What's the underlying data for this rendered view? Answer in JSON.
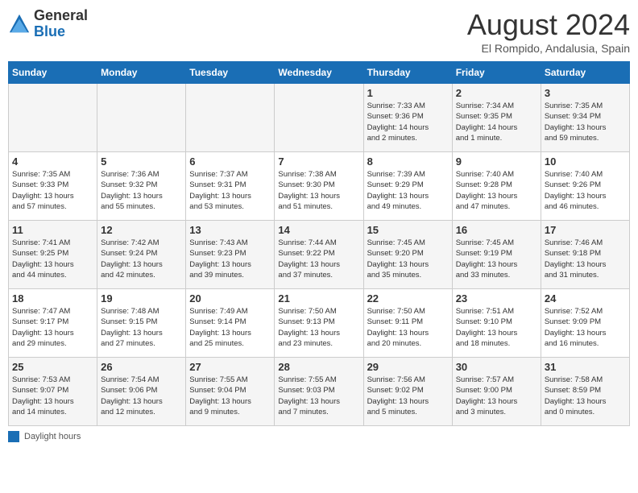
{
  "logo": {
    "general": "General",
    "blue": "Blue"
  },
  "title": {
    "month_year": "August 2024",
    "location": "El Rompido, Andalusia, Spain"
  },
  "weekdays": [
    "Sunday",
    "Monday",
    "Tuesday",
    "Wednesday",
    "Thursday",
    "Friday",
    "Saturday"
  ],
  "weeks": [
    [
      {
        "day": "",
        "info": ""
      },
      {
        "day": "",
        "info": ""
      },
      {
        "day": "",
        "info": ""
      },
      {
        "day": "",
        "info": ""
      },
      {
        "day": "1",
        "info": "Sunrise: 7:33 AM\nSunset: 9:36 PM\nDaylight: 14 hours\nand 2 minutes."
      },
      {
        "day": "2",
        "info": "Sunrise: 7:34 AM\nSunset: 9:35 PM\nDaylight: 14 hours\nand 1 minute."
      },
      {
        "day": "3",
        "info": "Sunrise: 7:35 AM\nSunset: 9:34 PM\nDaylight: 13 hours\nand 59 minutes."
      }
    ],
    [
      {
        "day": "4",
        "info": "Sunrise: 7:35 AM\nSunset: 9:33 PM\nDaylight: 13 hours\nand 57 minutes."
      },
      {
        "day": "5",
        "info": "Sunrise: 7:36 AM\nSunset: 9:32 PM\nDaylight: 13 hours\nand 55 minutes."
      },
      {
        "day": "6",
        "info": "Sunrise: 7:37 AM\nSunset: 9:31 PM\nDaylight: 13 hours\nand 53 minutes."
      },
      {
        "day": "7",
        "info": "Sunrise: 7:38 AM\nSunset: 9:30 PM\nDaylight: 13 hours\nand 51 minutes."
      },
      {
        "day": "8",
        "info": "Sunrise: 7:39 AM\nSunset: 9:29 PM\nDaylight: 13 hours\nand 49 minutes."
      },
      {
        "day": "9",
        "info": "Sunrise: 7:40 AM\nSunset: 9:28 PM\nDaylight: 13 hours\nand 47 minutes."
      },
      {
        "day": "10",
        "info": "Sunrise: 7:40 AM\nSunset: 9:26 PM\nDaylight: 13 hours\nand 46 minutes."
      }
    ],
    [
      {
        "day": "11",
        "info": "Sunrise: 7:41 AM\nSunset: 9:25 PM\nDaylight: 13 hours\nand 44 minutes."
      },
      {
        "day": "12",
        "info": "Sunrise: 7:42 AM\nSunset: 9:24 PM\nDaylight: 13 hours\nand 42 minutes."
      },
      {
        "day": "13",
        "info": "Sunrise: 7:43 AM\nSunset: 9:23 PM\nDaylight: 13 hours\nand 39 minutes."
      },
      {
        "day": "14",
        "info": "Sunrise: 7:44 AM\nSunset: 9:22 PM\nDaylight: 13 hours\nand 37 minutes."
      },
      {
        "day": "15",
        "info": "Sunrise: 7:45 AM\nSunset: 9:20 PM\nDaylight: 13 hours\nand 35 minutes."
      },
      {
        "day": "16",
        "info": "Sunrise: 7:45 AM\nSunset: 9:19 PM\nDaylight: 13 hours\nand 33 minutes."
      },
      {
        "day": "17",
        "info": "Sunrise: 7:46 AM\nSunset: 9:18 PM\nDaylight: 13 hours\nand 31 minutes."
      }
    ],
    [
      {
        "day": "18",
        "info": "Sunrise: 7:47 AM\nSunset: 9:17 PM\nDaylight: 13 hours\nand 29 minutes."
      },
      {
        "day": "19",
        "info": "Sunrise: 7:48 AM\nSunset: 9:15 PM\nDaylight: 13 hours\nand 27 minutes."
      },
      {
        "day": "20",
        "info": "Sunrise: 7:49 AM\nSunset: 9:14 PM\nDaylight: 13 hours\nand 25 minutes."
      },
      {
        "day": "21",
        "info": "Sunrise: 7:50 AM\nSunset: 9:13 PM\nDaylight: 13 hours\nand 23 minutes."
      },
      {
        "day": "22",
        "info": "Sunrise: 7:50 AM\nSunset: 9:11 PM\nDaylight: 13 hours\nand 20 minutes."
      },
      {
        "day": "23",
        "info": "Sunrise: 7:51 AM\nSunset: 9:10 PM\nDaylight: 13 hours\nand 18 minutes."
      },
      {
        "day": "24",
        "info": "Sunrise: 7:52 AM\nSunset: 9:09 PM\nDaylight: 13 hours\nand 16 minutes."
      }
    ],
    [
      {
        "day": "25",
        "info": "Sunrise: 7:53 AM\nSunset: 9:07 PM\nDaylight: 13 hours\nand 14 minutes."
      },
      {
        "day": "26",
        "info": "Sunrise: 7:54 AM\nSunset: 9:06 PM\nDaylight: 13 hours\nand 12 minutes."
      },
      {
        "day": "27",
        "info": "Sunrise: 7:55 AM\nSunset: 9:04 PM\nDaylight: 13 hours\nand 9 minutes."
      },
      {
        "day": "28",
        "info": "Sunrise: 7:55 AM\nSunset: 9:03 PM\nDaylight: 13 hours\nand 7 minutes."
      },
      {
        "day": "29",
        "info": "Sunrise: 7:56 AM\nSunset: 9:02 PM\nDaylight: 13 hours\nand 5 minutes."
      },
      {
        "day": "30",
        "info": "Sunrise: 7:57 AM\nSunset: 9:00 PM\nDaylight: 13 hours\nand 3 minutes."
      },
      {
        "day": "31",
        "info": "Sunrise: 7:58 AM\nSunset: 8:59 PM\nDaylight: 13 hours\nand 0 minutes."
      }
    ]
  ],
  "footer": {
    "legend_label": "Daylight hours"
  }
}
